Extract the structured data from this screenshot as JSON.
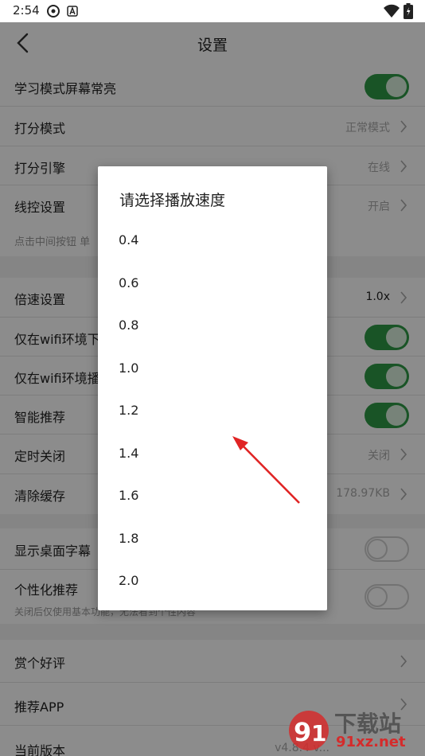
{
  "status_bar": {
    "time": "2:54"
  },
  "app_bar": {
    "title": "设置"
  },
  "settings": {
    "keep_screen_on": {
      "label": "学习模式屏幕常亮",
      "on": true
    },
    "scoring_mode": {
      "label": "打分模式",
      "value": "正常模式"
    },
    "scoring_engine": {
      "label": "打分引擎",
      "value": "在线"
    },
    "wire_control": {
      "label": "线控设置",
      "value": "开启"
    },
    "wire_hint": "点击中间按钮 单",
    "speed": {
      "label": "倍速设置",
      "value": "1.0x"
    },
    "wifi_only_1": {
      "label": "仅在wifi环境下",
      "on": true
    },
    "wifi_only_2": {
      "label": "仅在wifi环境播",
      "on": true
    },
    "smart_recommend": {
      "label": "智能推荐",
      "on": true
    },
    "timer_off": {
      "label": "定时关闭",
      "value": "关闭"
    },
    "clear_cache": {
      "label": "清除缓存",
      "value": "178.97KB"
    },
    "desktop_subtitle": {
      "label": "显示桌面字幕",
      "on": false
    },
    "personalized": {
      "label": "个性化推荐",
      "sub": "关闭后仅使用基本功能，无法看到个性内容",
      "on": false
    },
    "rate": {
      "label": "赏个好评"
    },
    "recommend_app": {
      "label": "推荐APP"
    },
    "version": {
      "label": "当前版本",
      "value": "v4.8.4 v..."
    }
  },
  "dialog": {
    "title": "请选择播放速度",
    "options": [
      "0.4",
      "0.6",
      "0.8",
      "1.0",
      "1.2",
      "1.4",
      "1.6",
      "1.8",
      "2.0"
    ]
  },
  "watermark": {
    "line1": "下载站",
    "line2": "91xz.net"
  },
  "colors": {
    "toggle_on": "#2f9a45",
    "arrow": "#e02424",
    "scrim": "rgba(0,0,0,0.45)"
  }
}
